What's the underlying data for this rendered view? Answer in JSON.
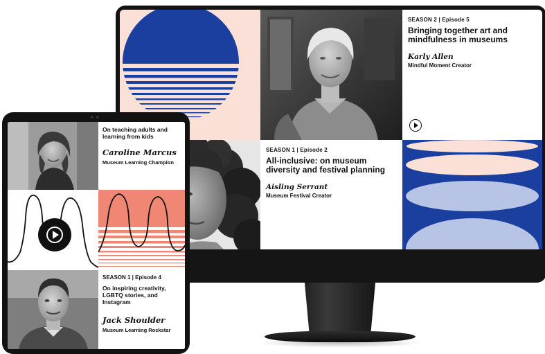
{
  "colors": {
    "navy": "#1b3f9e",
    "peach": "#fbe0d7",
    "coral": "#f08674",
    "lilac": "#b7c4e6",
    "bezel": "#131313"
  },
  "desktop": {
    "episodes": [
      {
        "label": "SEASON 2  |  Episode 5",
        "title": "Bringing together art and mindfulness in museums",
        "host": "Karly Allen",
        "role": "Mindful Moment Creator"
      },
      {
        "label": "SEASON 1  |  Episode 2",
        "title": "All-inclusive: on museum diversity and festival planning",
        "host": "Aisling Serrant",
        "role": "Museum Festival Creator"
      }
    ]
  },
  "tablet": {
    "episodes": [
      {
        "title": "On teaching adults and learning from kids",
        "host": "Caroline Marcus",
        "role": "Museum Learning Champion"
      },
      {
        "label": "SEASON 1  |  Episode 4",
        "title": "On inspiring creativity, LGBTQ stories, and Instagram",
        "host": "Jack Shoulder",
        "role": "Museum Learning Rockstar"
      }
    ]
  },
  "icons": [
    "play-circle-icon",
    "play-button-icon"
  ]
}
